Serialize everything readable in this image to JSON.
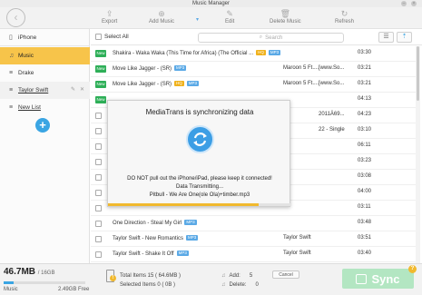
{
  "window": {
    "title": "Music Manager",
    "buttons": [
      "–",
      "×"
    ]
  },
  "toolbar": {
    "back": "‹",
    "export": "Export",
    "add_music": "Add Music",
    "add_music_caret": "▾",
    "edit": "Edit",
    "delete_music": "Delete Music",
    "refresh": "Refresh"
  },
  "sidebar": {
    "device": "iPhone",
    "items": [
      {
        "label": "Music"
      },
      {
        "label": "Drake"
      },
      {
        "label": "Taylor Swift"
      },
      {
        "label": "New List"
      }
    ],
    "add": "+"
  },
  "list": {
    "select_all": "Select All",
    "search_placeholder": "Search",
    "rows": [
      {
        "new": "New",
        "name": "Shakira - Waka Waka (This Time for Africa) (The Official ...",
        "badges": [
          "HQ",
          "MP3"
        ],
        "artist": "",
        "album": "",
        "duration": "03:30"
      },
      {
        "new": "New",
        "name": "Move Like Jagger - (SR)",
        "badges": [
          "MP3"
        ],
        "artist": "Maroon 5 Ft....",
        "album": "[www.So...",
        "duration": "03:21"
      },
      {
        "new": "New",
        "name": "Move Like Jagger - (SR)",
        "badges": [
          "HQ",
          "MP3"
        ],
        "artist": "Maroon 5 Ft....",
        "album": "[www.So...",
        "duration": "03:21"
      },
      {
        "new": "New",
        "name": "",
        "badges": [],
        "artist": "",
        "album": "",
        "duration": "04:13"
      },
      {
        "new": "",
        "name": "",
        "badges": [],
        "artist": "",
        "album": "2011Ä69...",
        "duration": "04:23"
      },
      {
        "new": "",
        "name": "",
        "badges": [],
        "artist": "",
        "album": "22 - Single",
        "duration": "03:10"
      },
      {
        "new": "",
        "name": "",
        "badges": [],
        "artist": "",
        "album": "",
        "duration": "06:11"
      },
      {
        "new": "",
        "name": "",
        "badges": [],
        "artist": "",
        "album": "",
        "duration": "03:23"
      },
      {
        "new": "",
        "name": "",
        "badges": [],
        "artist": "",
        "album": "",
        "duration": "03:08"
      },
      {
        "new": "",
        "name": "",
        "badges": [],
        "artist": "",
        "album": "",
        "duration": "04:00"
      },
      {
        "new": "",
        "name": "",
        "badges": [],
        "artist": "",
        "album": "",
        "duration": "03:11"
      },
      {
        "new": "",
        "name": "One Direction - Steal My Girl",
        "badges": [
          "MP3"
        ],
        "artist": "",
        "album": "",
        "duration": "03:48"
      },
      {
        "new": "",
        "name": "Taylor Swift - New Romantics",
        "badges": [
          "MP3"
        ],
        "artist": "Taylor Swift",
        "album": "",
        "duration": "03:51"
      },
      {
        "new": "",
        "name": "Taylor Swift - Shake It Off",
        "badges": [
          "MP3"
        ],
        "artist": "Taylor Swift",
        "album": "",
        "duration": "03:40"
      }
    ]
  },
  "modal": {
    "title": "MediaTrans is synchronizing data",
    "line1": "DO NOT pull out the iPhone/iPad, please keep it connected!",
    "line2": "Data Transmitting...",
    "line3": "Pitbull - We Are One(ole Ola)+timber.mp3",
    "progress": 0.82
  },
  "footer": {
    "used": "46.7MB",
    "capacity": "/ 16GB",
    "storage_fill": 0.12,
    "music_label": "Music",
    "free": "2.49GB Free",
    "total_items": "Total Items 15 ( 64.6MB )",
    "selected_items": "Selected Items 0 ( 0B )",
    "add_label": "Add:",
    "add_count": "5",
    "delete_label": "Delete:",
    "delete_count": "0",
    "cancel": "Cancel",
    "sync": "Sync",
    "help": "?"
  },
  "colors": {
    "accent": "#f7c44a",
    "blue": "#3aa5e3",
    "new_badge": "#2eaf58",
    "sync_green": "#b3e6c2"
  },
  "icons": [
    "back-arrow-icon",
    "export-icon",
    "add-music-icon",
    "edit-icon",
    "delete-icon",
    "refresh-icon",
    "phone-icon",
    "headphones-icon",
    "playlist-icon",
    "search-icon",
    "list-view-icon",
    "add-to-device-icon",
    "sync-icon",
    "document-icon",
    "warning-icon",
    "help-icon"
  ]
}
